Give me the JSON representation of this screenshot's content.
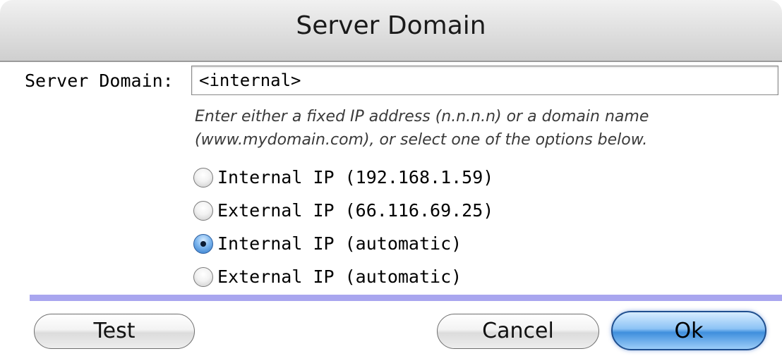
{
  "window": {
    "title": "Server Domain"
  },
  "field": {
    "label": "Server Domain:",
    "value": "<internal>",
    "hint_lines": [
      "Enter either a fixed IP address (n.n.n.n) or a domain name",
      "(www.mydomain.com), or select one of the options below."
    ]
  },
  "options": [
    {
      "label": "Internal IP (192.168.1.59)",
      "selected": false
    },
    {
      "label": "External IP (66.116.69.25)",
      "selected": false
    },
    {
      "label": "Internal IP (automatic)",
      "selected": true
    },
    {
      "label": "External IP (automatic)",
      "selected": false
    }
  ],
  "buttons": {
    "test": "Test",
    "cancel": "Cancel",
    "ok": "Ok"
  },
  "colors": {
    "separator": "#a9a6ef",
    "default_button": "#3f8fdd"
  }
}
